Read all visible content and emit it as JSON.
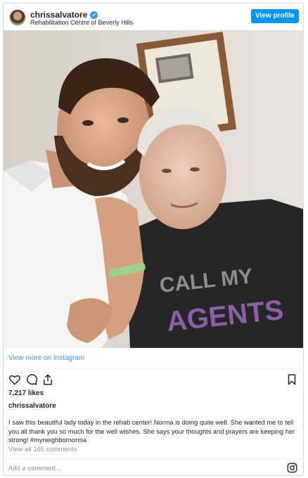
{
  "header": {
    "username": "chrissalvatore",
    "verified_badge": "✓",
    "location": "Rehabilitation Centre of Beverly Hills",
    "view_profile_label": "View profile"
  },
  "photo": {
    "shirt_text_line1": "CALL MY",
    "shirt_text_line2": "AGENTS"
  },
  "view_more_label": "View more on Instagram",
  "actions": {
    "icons": [
      "heart-icon",
      "comment-icon",
      "share-icon",
      "bookmark-icon"
    ]
  },
  "likes": "7,217 likes",
  "caption": {
    "username": "chrissalvatore",
    "text": "I saw this beautiful lady today in the rehab center! Norma is doing quite well. She wanted me to tell you all thank you so much for the well wishes. She says your thoughts and prayers are keeping her strong! #myneighbornorma"
  },
  "comments_link": "View all 165 comments",
  "comment_bar": {
    "placeholder": "Add a comment..."
  },
  "colors": {
    "accent": "#3897f0",
    "button": "#0095f6",
    "text": "#262626",
    "muted": "#8e8e8e",
    "border": "#dbdbdb"
  }
}
